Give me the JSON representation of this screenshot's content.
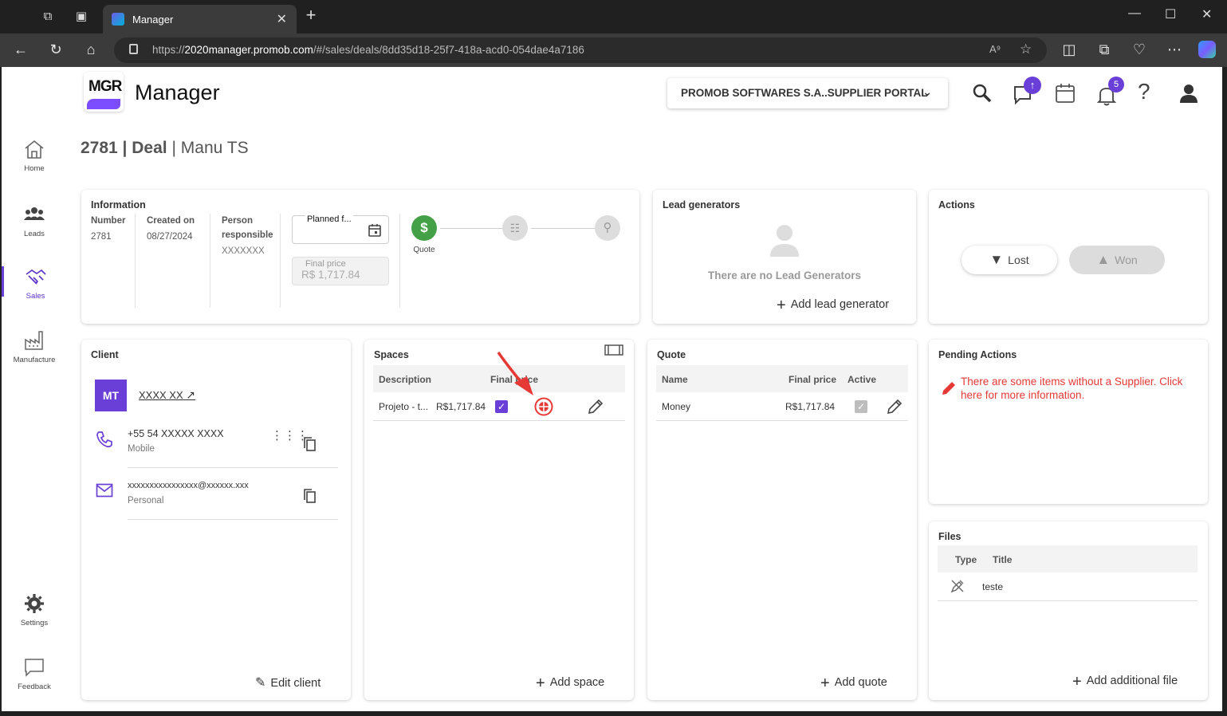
{
  "browser": {
    "tab_title": "Manager",
    "url_prefix": "https://",
    "url_host": "2020manager.promob.com",
    "url_path": "/#/sales/deals/8dd35d18-25f7-418a-acd0-054dae4a7186"
  },
  "header": {
    "logo_text": "MGR",
    "app_name": "Manager",
    "org_selector": "PROMOB SOFTWARES S.A..SUPPLIER PORTAL",
    "notifications_count": "5"
  },
  "sidebar": {
    "items": [
      {
        "label": "Home",
        "icon": "home-icon"
      },
      {
        "label": "Leads",
        "icon": "people-icon"
      },
      {
        "label": "Sales",
        "icon": "handshake-icon"
      },
      {
        "label": "Manufacture",
        "icon": "factory-icon"
      },
      {
        "label": "Settings",
        "icon": "gear-icon"
      },
      {
        "label": "Feedback",
        "icon": "chat-bubble-icon"
      }
    ]
  },
  "deal": {
    "number_title": "2781 | Deal",
    "separator": "|",
    "client_name": "Manu TS"
  },
  "information": {
    "heading": "Information",
    "number_label": "Number",
    "number": "2781",
    "created_label": "Created on",
    "created": "08/27/2024",
    "person_label": "Person responsible",
    "person": "XXXXXXX",
    "planned_label": "Planned f...",
    "final_price_label": "Final price",
    "final_price": "R$ 1,717.84",
    "step_label": "Quote"
  },
  "lead_generators": {
    "heading": "Lead generators",
    "empty": "There are no Lead Generators",
    "add": "Add lead generator"
  },
  "actions": {
    "heading": "Actions",
    "lost": "Lost",
    "won": "Won"
  },
  "client": {
    "heading": "Client",
    "initials": "MT",
    "name": "XXXX XX",
    "phone": "+55 54 XXXXX XXXX",
    "phone_type": "Mobile",
    "email": "xxxxxxxxxxxxxxxx@xxxxxx.xxx",
    "email_type": "Personal",
    "edit": "Edit client"
  },
  "spaces": {
    "heading": "Spaces",
    "columns": [
      "Description",
      "Final price"
    ],
    "rows": [
      {
        "description": "Projeto - t...",
        "price": "R$1,717.84"
      }
    ],
    "add": "Add space"
  },
  "quote": {
    "heading": "Quote",
    "columns": [
      "Name",
      "Final price",
      "Active"
    ],
    "rows": [
      {
        "name": "Money",
        "price": "R$1,717.84"
      }
    ],
    "add": "Add quote"
  },
  "pending": {
    "heading": "Pending Actions",
    "message": "There are some items without a Supplier. Click here for more information."
  },
  "files": {
    "heading": "Files",
    "columns": [
      "Type",
      "Title"
    ],
    "rows": [
      {
        "title": "teste"
      }
    ],
    "add": "Add additional file"
  },
  "colors": {
    "accent": "#6a3fd8",
    "success": "#43a047",
    "error": "#e53935"
  }
}
